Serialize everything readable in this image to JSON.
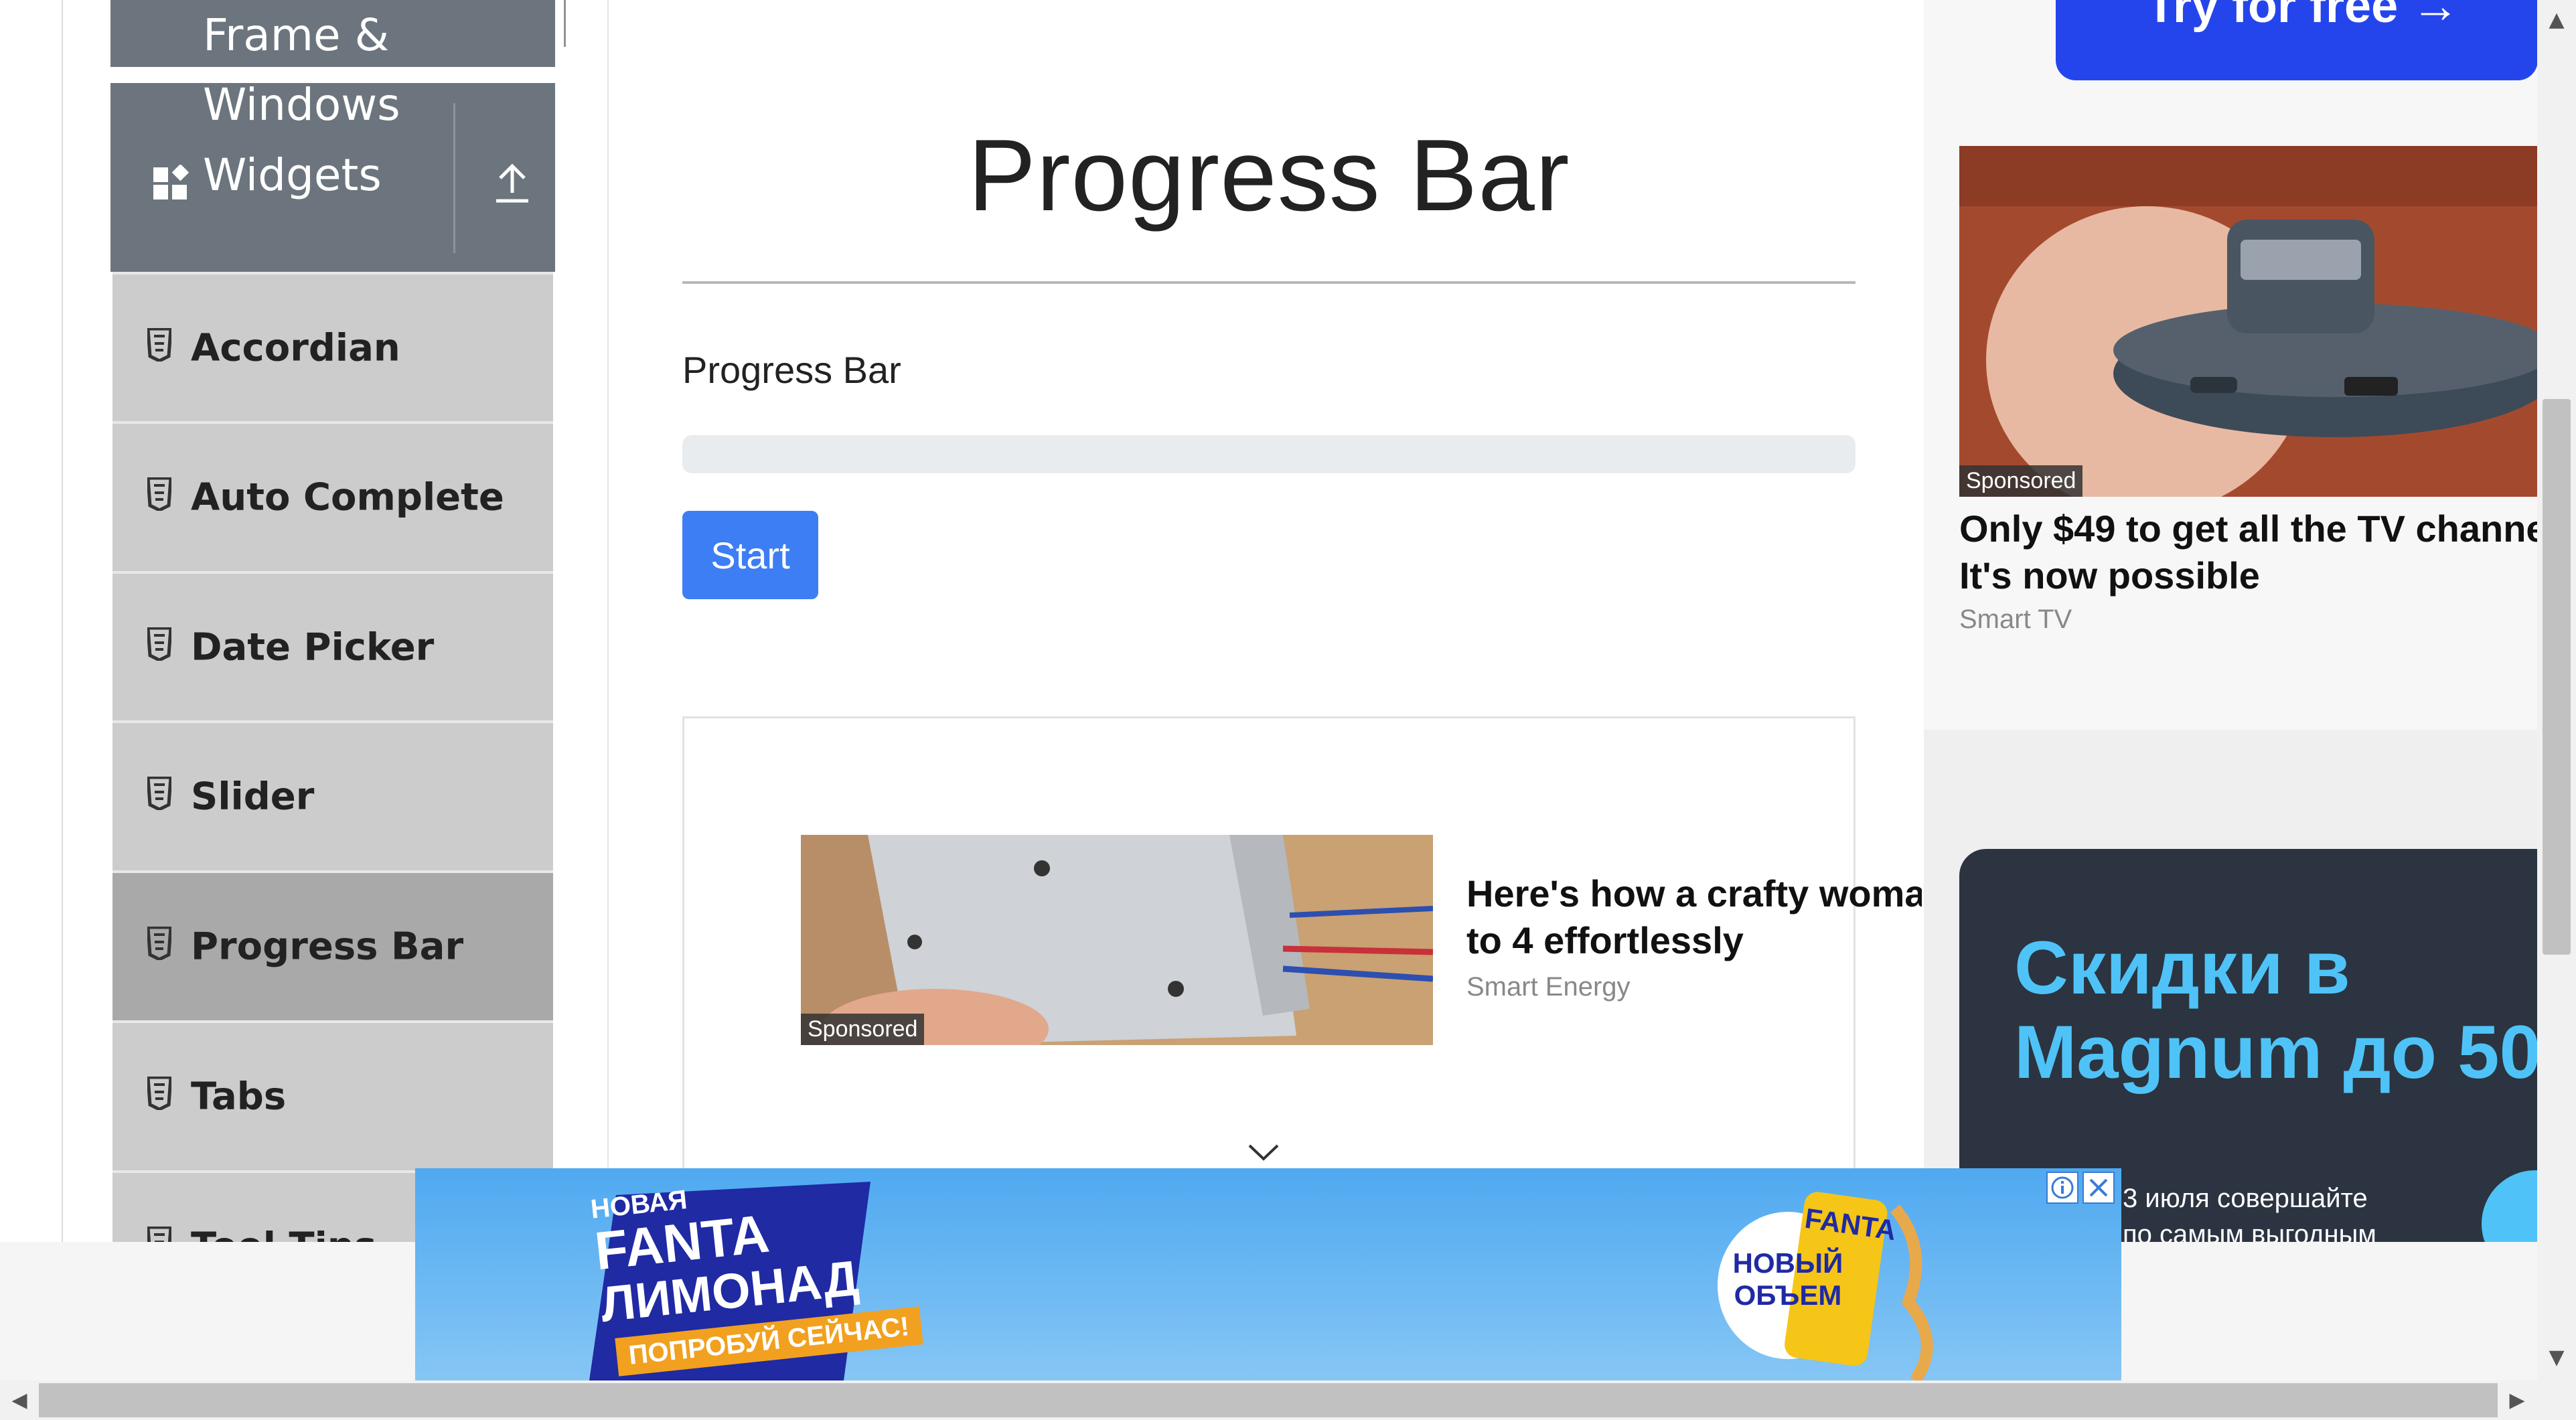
{
  "sidebar": {
    "groups": [
      {
        "label_line1": "Frame &",
        "label_line2": "Windows"
      },
      {
        "label": "Widgets",
        "collapse_icon": "upload-arrow-icon"
      }
    ],
    "items": [
      {
        "label": "Accordian",
        "icon": "html5-icon",
        "active": false
      },
      {
        "label": "Auto Complete",
        "icon": "html5-icon",
        "active": false
      },
      {
        "label": "Date Picker",
        "icon": "html5-icon",
        "active": false
      },
      {
        "label": "Slider",
        "icon": "html5-icon",
        "active": false
      },
      {
        "label": "Progress Bar",
        "icon": "html5-icon",
        "active": true
      },
      {
        "label": "Tabs",
        "icon": "html5-icon",
        "active": false
      },
      {
        "label": "Tool Tips",
        "icon": "html5-icon",
        "active": false
      }
    ]
  },
  "main": {
    "title": "Progress Bar",
    "progress_label": "Progress Bar",
    "progress_value": 0,
    "start_button": "Start",
    "ad": {
      "sponsored": "Sponsored",
      "headline_line1": "Here's how a crafty woma",
      "headline_line2": "to 4 effortlessly",
      "source": "Smart Energy",
      "chevron_icon": "chevron-down-icon"
    }
  },
  "right_ads": {
    "top_cta": "Try for free →",
    "card": {
      "sponsored": "Sponsored",
      "headline_line1": "Only $49 to get all the TV channe",
      "headline_line2": "It's now possible",
      "source": "Smart TV"
    },
    "promo": {
      "headline_line1": "Скидки в",
      "headline_line2": "Magnum до 50",
      "body_line1": "3 июля совершайте",
      "body_line2": "по самым выгодным"
    }
  },
  "banner": {
    "brand_line1": "НОВАЯ",
    "brand_line2": "FANTA",
    "brand_line3": "ЛИМОНАД",
    "cta": "ПОПРОБУЙ СЕЙЧАС!",
    "badge_line1": "НОВЫЙ",
    "badge_line2": "ОБЪЕМ",
    "can_text": "FANTA",
    "info_icon": "info-icon",
    "close_icon": "close-icon"
  },
  "colors": {
    "sidebar_group": "#6c757d",
    "menu_item": "#cccccc",
    "menu_item_active": "#a9a9a9",
    "button_primary": "#3d7ef4",
    "progress_track": "#e9ecef",
    "promo_headline": "#4fc3f7",
    "promo_bg": "#2b3440",
    "cta_blue": "#2545ec"
  }
}
